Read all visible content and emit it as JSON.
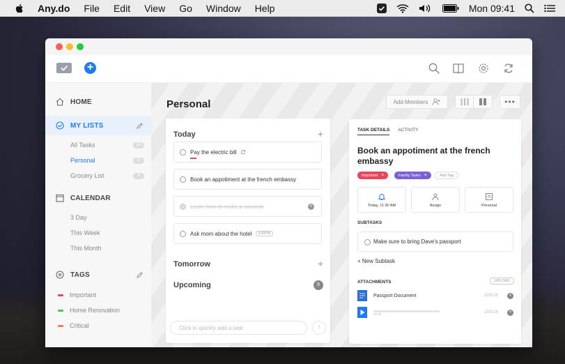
{
  "menubar": {
    "app_name": "Any.do",
    "items": [
      "File",
      "Edit",
      "View",
      "Go",
      "Window",
      "Help"
    ],
    "clock": "Mon 09:41"
  },
  "sidebar": {
    "home": "HOME",
    "my_lists": "MY LISTS",
    "lists": [
      {
        "label": "All Tasks",
        "count": "14"
      },
      {
        "label": "Personal",
        "count": "8"
      },
      {
        "label": "Grocery List",
        "count": "6"
      }
    ],
    "calendar": "CALENDAR",
    "calendar_items": [
      "3 Day",
      "This Week",
      "This Month"
    ],
    "tags": "TAGS",
    "tag_items": [
      {
        "label": "Important",
        "color": "#e8455e"
      },
      {
        "label": "Home Renovation",
        "color": "#4cc15e"
      },
      {
        "label": "Critical",
        "color": "#f07a52"
      }
    ]
  },
  "main": {
    "title": "Personal",
    "add_members": "Add Members",
    "sections": {
      "today": "Today",
      "tomorrow": "Tomorrow",
      "upcoming": "Upcoming",
      "upcoming_count": "9"
    },
    "tasks": [
      {
        "text": "Pay the electric bill"
      },
      {
        "text": "Book an appotiment at the french embassy"
      },
      {
        "text": "Learn how to make a souvlaki"
      },
      {
        "text": "Ask mom about the hotel",
        "badge": "3:00PM"
      }
    ],
    "quick_add_placeholder": "Click to quickly add a task"
  },
  "detail": {
    "tab_details": "TASK DETAILS",
    "tab_activity": "ACTIVITY",
    "title": "Book an appotiment at the french embassy",
    "tags": [
      {
        "label": "Important",
        "color": "#e8455e"
      },
      {
        "label": "Family Tasks",
        "color": "#7b61d6"
      }
    ],
    "add_tag": "Add Tag",
    "reminder": "Today, 11:30 AM",
    "assign": "Assign",
    "list": "Personal",
    "subtasks_label": "SUBTASKS",
    "subtask": "Make sure to bring Dave's passport",
    "new_subtask": "+ New Subtask",
    "attachments_label": "ATTACHMENTS",
    "upload": "UPLOAD",
    "attachments": [
      {
        "name": "Passport Document",
        "date": "2/05/16"
      },
      {
        "name": "",
        "time": "00:00",
        "date": "2/05/16"
      }
    ]
  },
  "colors": {
    "accent": "#1d7cf2",
    "important": "#e8455e"
  }
}
